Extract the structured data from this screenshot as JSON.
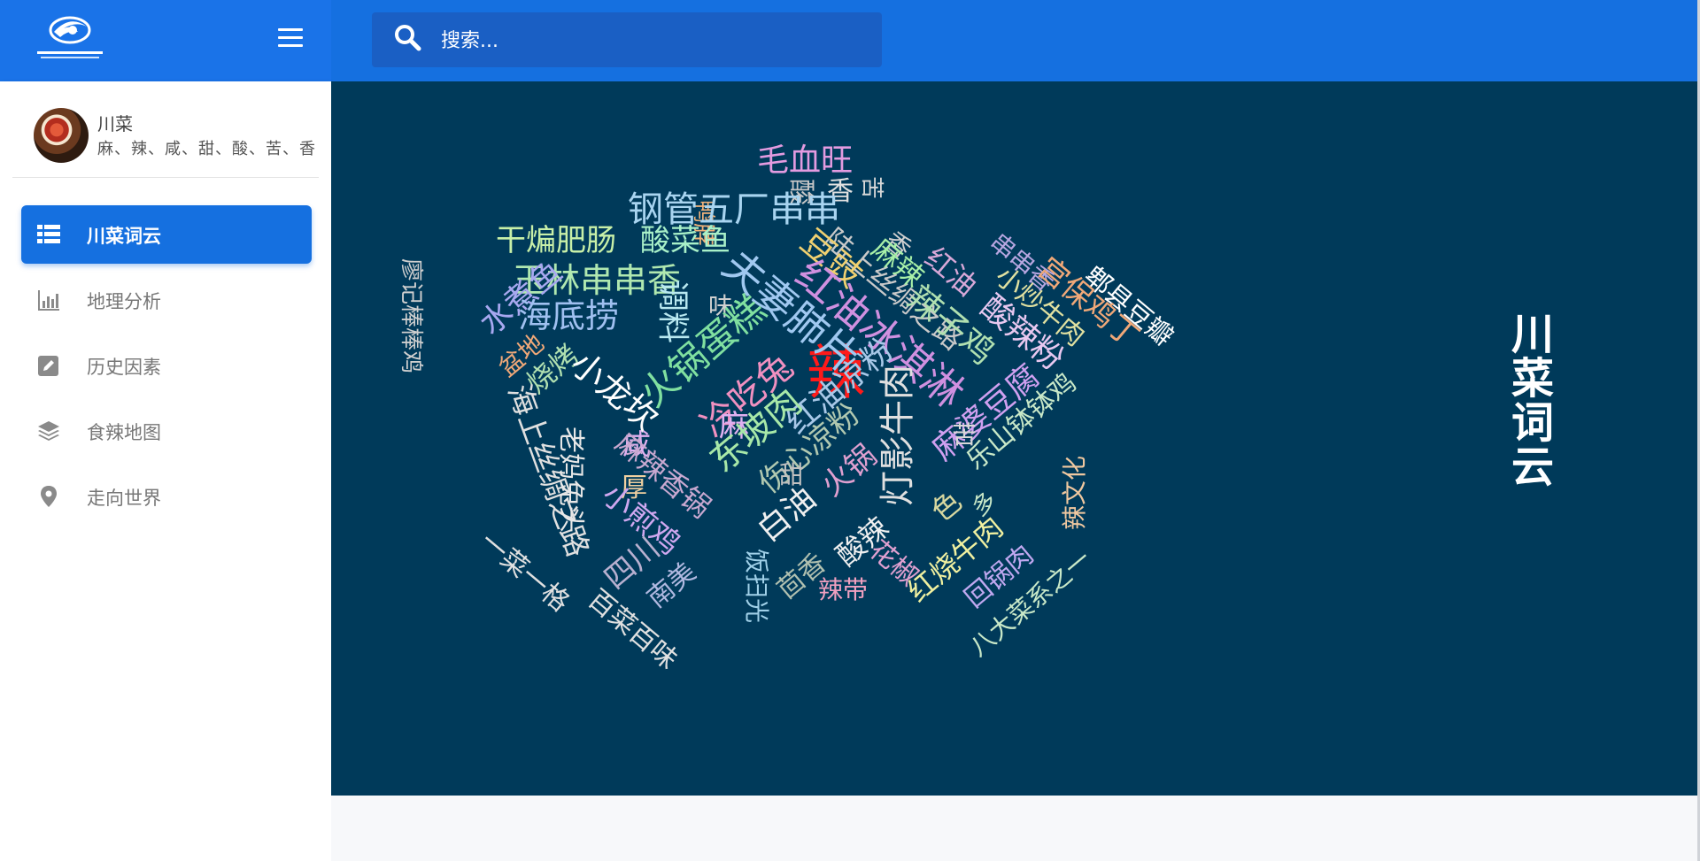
{
  "header": {
    "logo_icon": "swirl-logo",
    "menu_icon": "hamburger-icon",
    "search": {
      "placeholder": "搜索...",
      "icon": "search-icon"
    }
  },
  "profile": {
    "name": "川菜",
    "description": "麻、辣、咸、甜、酸、苦、香"
  },
  "nav": {
    "items": [
      {
        "label": "川菜词云",
        "icon": "list-icon",
        "active": true
      },
      {
        "label": "地理分析",
        "icon": "bar-chart-icon",
        "active": false
      },
      {
        "label": "历史因素",
        "icon": "edit-icon",
        "active": false
      },
      {
        "label": "食辣地图",
        "icon": "layers-icon",
        "active": false
      },
      {
        "label": "走向世界",
        "icon": "map-pin-icon",
        "active": false
      }
    ]
  },
  "panel": {
    "title": "川菜词云",
    "background": "#003a5a"
  },
  "word_cloud": [
    {
      "text": "辣",
      "color": "#ff1a1a"
    },
    {
      "text": "毛血旺",
      "color": "#e39be0"
    },
    {
      "text": "陆上丝绸之路",
      "color": "#c9c9c9"
    },
    {
      "text": "香",
      "color": "#e0e0e0"
    },
    {
      "text": "酸",
      "color": "#c7c7c7"
    },
    {
      "text": "苦",
      "color": "#d8d8d8"
    },
    {
      "text": "鸭脖",
      "color": "#f0b27a"
    },
    {
      "text": "钢管五厂串串",
      "color": "#a8d4f0"
    },
    {
      "text": "串串香",
      "color": "#b7a6e0"
    },
    {
      "text": "郫县豆瓣",
      "color": "#ffffff"
    },
    {
      "text": "干煸肥肠",
      "color": "#c8f0a8"
    },
    {
      "text": "酸菜鱼",
      "color": "#a8f0c8"
    },
    {
      "text": "香",
      "color": "#d0d0d0"
    },
    {
      "text": "豆豉",
      "color": "#f0d070"
    },
    {
      "text": "麻辣",
      "color": "#a8f0a8"
    },
    {
      "text": "红油",
      "color": "#d8a8d8"
    },
    {
      "text": "小炒牛肉",
      "color": "#e0e0a0"
    },
    {
      "text": "宫保鸡丁",
      "color": "#f0a878"
    },
    {
      "text": "廖记棒棒鸡",
      "color": "#cfcfcf"
    },
    {
      "text": "玉林串串香",
      "color": "#b0e8b0"
    },
    {
      "text": "水煮鱼",
      "color": "#a8a8f0"
    },
    {
      "text": "夫妻肺片",
      "color": "#a0c8f0"
    },
    {
      "text": "辣子鸡",
      "color": "#b0e0b0"
    },
    {
      "text": "酸辣粉",
      "color": "#e8c8f0"
    },
    {
      "text": "海底捞",
      "color": "#a0c0f0"
    },
    {
      "text": "味",
      "color": "#d0d0d0"
    },
    {
      "text": "调料",
      "color": "#b8e8f0"
    },
    {
      "text": "火锅蛋糕",
      "color": "#80e0a0"
    },
    {
      "text": "红油冰淇淋",
      "color": "#d090e0"
    },
    {
      "text": "盆地",
      "color": "#f0a878"
    },
    {
      "text": "烧烤",
      "color": "#b0e0b0"
    },
    {
      "text": "小龙坎",
      "color": "#ffffff"
    },
    {
      "text": "冷吃兔",
      "color": "#f090c0"
    },
    {
      "text": "麻",
      "color": "#e0b0f0"
    },
    {
      "text": "红油凉粉",
      "color": "#a8c8e8"
    },
    {
      "text": "麻婆豆腐",
      "color": "#d0a0f0"
    },
    {
      "text": "乐山钵钵鸡",
      "color": "#c8e8c8"
    },
    {
      "text": "海上丝绸之路",
      "color": "#e0e0e0"
    },
    {
      "text": "咸",
      "color": "#e0b0f0"
    },
    {
      "text": "东坡肉",
      "color": "#a8e8a8"
    },
    {
      "text": "伤心凉粉",
      "color": "#b0c8b0"
    },
    {
      "text": "灯影牛肉",
      "color": "#e0e0e0"
    },
    {
      "text": "苦",
      "color": "#d8d8d8"
    },
    {
      "text": "老妈兔头",
      "color": "#e8e8e8"
    },
    {
      "text": "厚",
      "color": "#f0d0a0"
    },
    {
      "text": "麻辣香锅",
      "color": "#c8a8d0"
    },
    {
      "text": "甜",
      "color": "#c0c0c0"
    },
    {
      "text": "火锅",
      "color": "#e0a0d0"
    },
    {
      "text": "色",
      "color": "#d8d8a0"
    },
    {
      "text": "多",
      "color": "#c8e8c8"
    },
    {
      "text": "辣文化",
      "color": "#f0c8a0"
    },
    {
      "text": "一菜一格",
      "color": "#e0e0e0"
    },
    {
      "text": "小煎鸡",
      "color": "#d0a8f0"
    },
    {
      "text": "白油",
      "color": "#f0f0f0"
    },
    {
      "text": "酸辣",
      "color": "#f0f0f0"
    },
    {
      "text": "红烧牛肉",
      "color": "#f0f0a0"
    },
    {
      "text": "四川",
      "color": "#b8b0d0"
    },
    {
      "text": "南美",
      "color": "#b0b8e0"
    },
    {
      "text": "饭扫光",
      "color": "#a0d0e8"
    },
    {
      "text": "茴香",
      "color": "#b0c0b0"
    },
    {
      "text": "辣带",
      "color": "#f0a0c0"
    },
    {
      "text": "花椒",
      "color": "#e0a0d0"
    },
    {
      "text": "回锅肉",
      "color": "#c0a8f0"
    },
    {
      "text": "百菜百味",
      "color": "#e0e0e0"
    },
    {
      "text": "八大菜系之一",
      "color": "#c8e8c8"
    }
  ]
}
